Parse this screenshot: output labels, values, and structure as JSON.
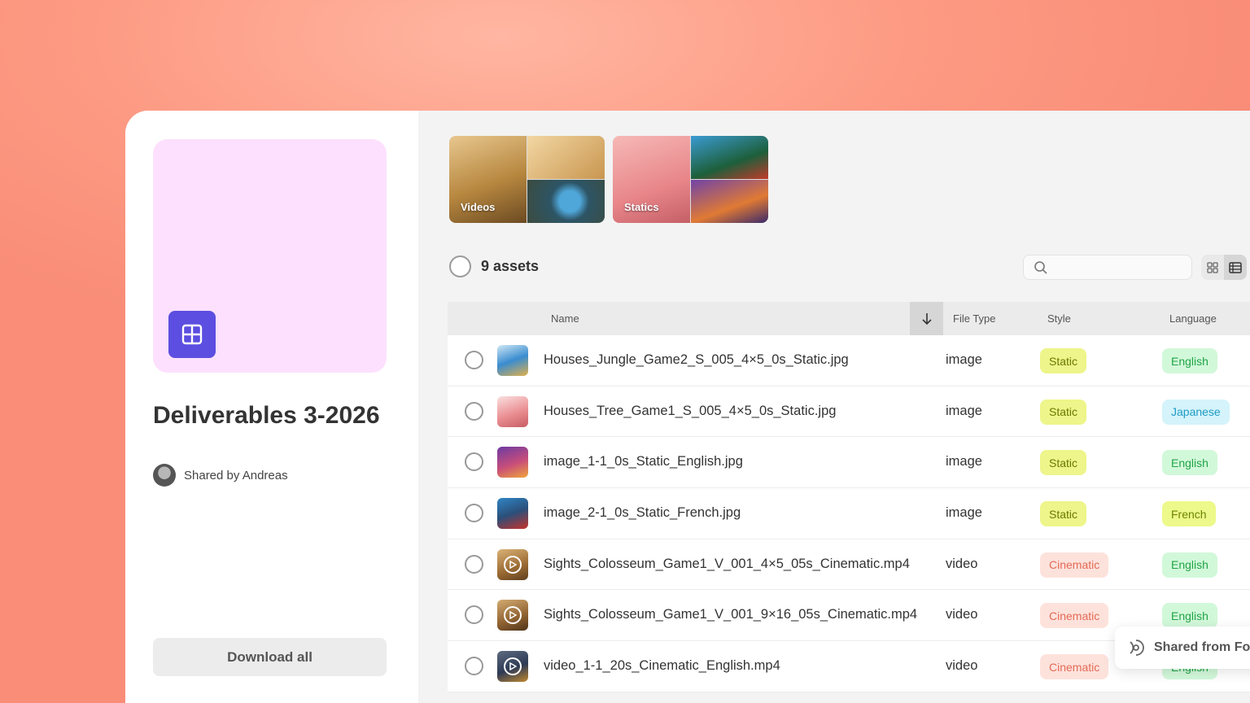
{
  "collection": {
    "title": "Deliverables 3-2026",
    "shared_by": "Shared by Andreas",
    "download_label": "Download all",
    "cover_color": "#fde0fd",
    "cover_icon": "grid-icon",
    "accent": "#5b4ee0"
  },
  "folders": [
    {
      "label": "Videos"
    },
    {
      "label": "Statics"
    }
  ],
  "toolbar": {
    "assets_count": "9 assets",
    "search_placeholder": ""
  },
  "table": {
    "columns": {
      "name": "Name",
      "file_type": "File Type",
      "style": "Style",
      "language": "Language"
    },
    "rows": [
      {
        "name": "Houses_Jungle_Game2_S_005_4×5_0s_Static.jpg",
        "type": "image",
        "style": "Static",
        "language": "English"
      },
      {
        "name": "Houses_Tree_Game1_S_005_4×5_0s_Static.jpg",
        "type": "image",
        "style": "Static",
        "language": "Japanese"
      },
      {
        "name": "image_1-1_0s_Static_English.jpg",
        "type": "image",
        "style": "Static",
        "language": "English"
      },
      {
        "name": "image_2-1_0s_Static_French.jpg",
        "type": "image",
        "style": "Static",
        "language": "French"
      },
      {
        "name": "Sights_Colosseum_Game1_V_001_4×5_05s_Cinematic.mp4",
        "type": "video",
        "style": "Cinematic",
        "language": "English"
      },
      {
        "name": "Sights_Colosseum_Game1_V_001_9×16_05s_Cinematic.mp4",
        "type": "video",
        "style": "Cinematic",
        "language": "English"
      },
      {
        "name": "video_1-1_20s_Cinematic_English.mp4",
        "type": "video",
        "style": "Cinematic",
        "language": "English"
      }
    ]
  },
  "toast": {
    "text": "Shared from Fo"
  }
}
